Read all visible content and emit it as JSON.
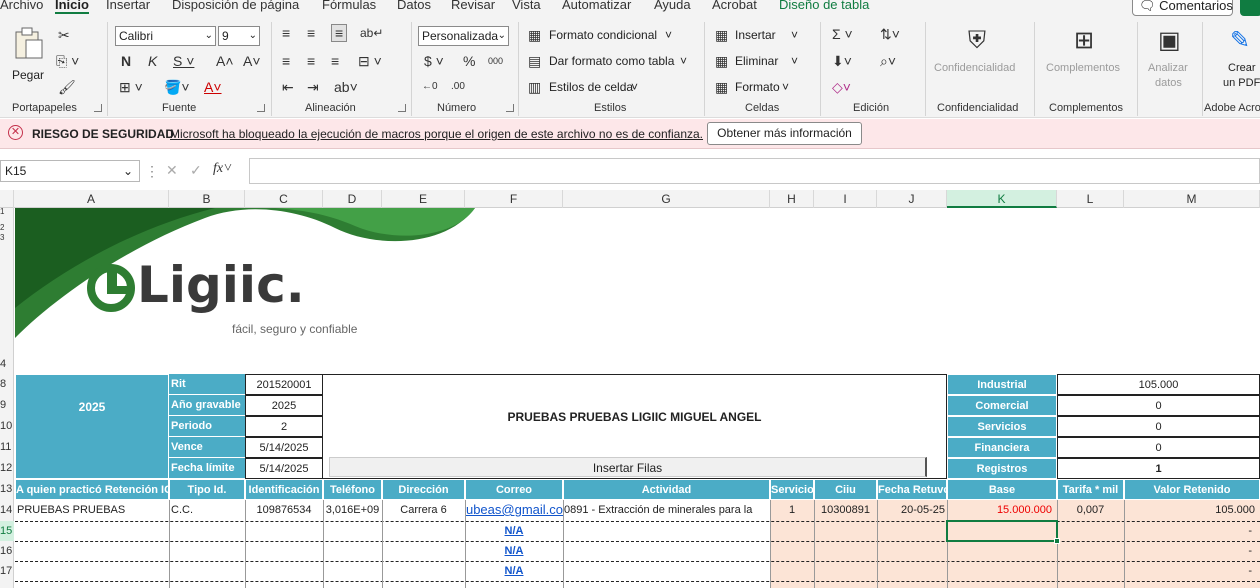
{
  "menu": [
    "Archivo",
    "Inicio",
    "Insertar",
    "Disposición de página",
    "Fórmulas",
    "Datos",
    "Revisar",
    "Vista",
    "Automatizar",
    "Ayuda",
    "Acrobat",
    "Diseño de tabla"
  ],
  "comments_label": "Comentarios",
  "ribbon": {
    "paste": "Pegar",
    "groups": {
      "portapapeles": "Portapapeles",
      "fuente": "Fuente",
      "alineacion": "Alineación",
      "numero": "Número",
      "estilos": "Estilos",
      "celdas": "Celdas",
      "edicion": "Edición",
      "confidencialidad": "Confidencialidad",
      "complementos": "Complementos",
      "adobe": "Adobe Acro"
    },
    "font_name": "Calibri",
    "font_size": "9",
    "number_format": "Personalizada",
    "styles": [
      "Formato condicional",
      "Dar formato como tabla",
      "Estilos de celda"
    ],
    "cells": [
      "Insertar",
      "Eliminar",
      "Formato"
    ],
    "big": {
      "confidencialidad": "Confidencialidad",
      "complementos": "Complementos",
      "analizar1": "Analizar",
      "analizar2": "datos",
      "crear1": "Crear",
      "crear2": "un PDF"
    }
  },
  "security": {
    "title": "RIESGO DE SEGURIDAD",
    "message": "Microsoft ha bloqueado la ejecución de macros porque el origen de este archivo no es de confianza.",
    "button": "Obtener más información"
  },
  "name_box": "K15",
  "columns": [
    "A",
    "B",
    "C",
    "D",
    "E",
    "F",
    "G",
    "H",
    "I",
    "J",
    "K",
    "L",
    "M"
  ],
  "selected_column": "K",
  "rows": [
    "1",
    "2",
    "3",
    "4",
    "8",
    "9",
    "10",
    "11",
    "12",
    "13",
    "14",
    "15",
    "16",
    "17"
  ],
  "sheet": {
    "logo": {
      "word": "Ligiic.",
      "tagline": "fácil, seguro y confiable"
    },
    "year_block": "2025",
    "info_labels": [
      "Rit",
      "Año gravable",
      "Periodo",
      "Vence",
      "Fecha límite"
    ],
    "info_values": [
      "201520001",
      "2025",
      "2",
      "5/14/2025",
      "5/14/2025"
    ],
    "company_name": "PRUEBAS PRUEBAS LIGIIC MIGUEL ANGEL",
    "insert_rows": "Insertar Filas",
    "summary_labels": [
      "Industrial",
      "Comercial",
      "Servicios",
      "Financiera",
      "Registros"
    ],
    "summary_values": [
      "105.000",
      "0",
      "0",
      "0",
      "1"
    ],
    "headers": [
      "A quien practicó Retención ICA",
      "Tipo Id.",
      "Identificación",
      "Teléfono",
      "Dirección",
      "Correo",
      "Actividad",
      "Servicio",
      "Ciiu",
      "Fecha Retuvo",
      "Base",
      "Tarifa * mil",
      "Valor Retenido"
    ],
    "row14": [
      "PRUEBAS PRUEBAS",
      "C.C.",
      "109876534",
      "3,016E+09",
      "Carrera 6",
      "ubeas@gmail.co",
      "0891 - Extracción de minerales para la",
      "1",
      "10300891",
      "20-05-25",
      "15.000.000",
      "0,007",
      "105.000"
    ],
    "na": "N/A",
    "dash": "-"
  }
}
